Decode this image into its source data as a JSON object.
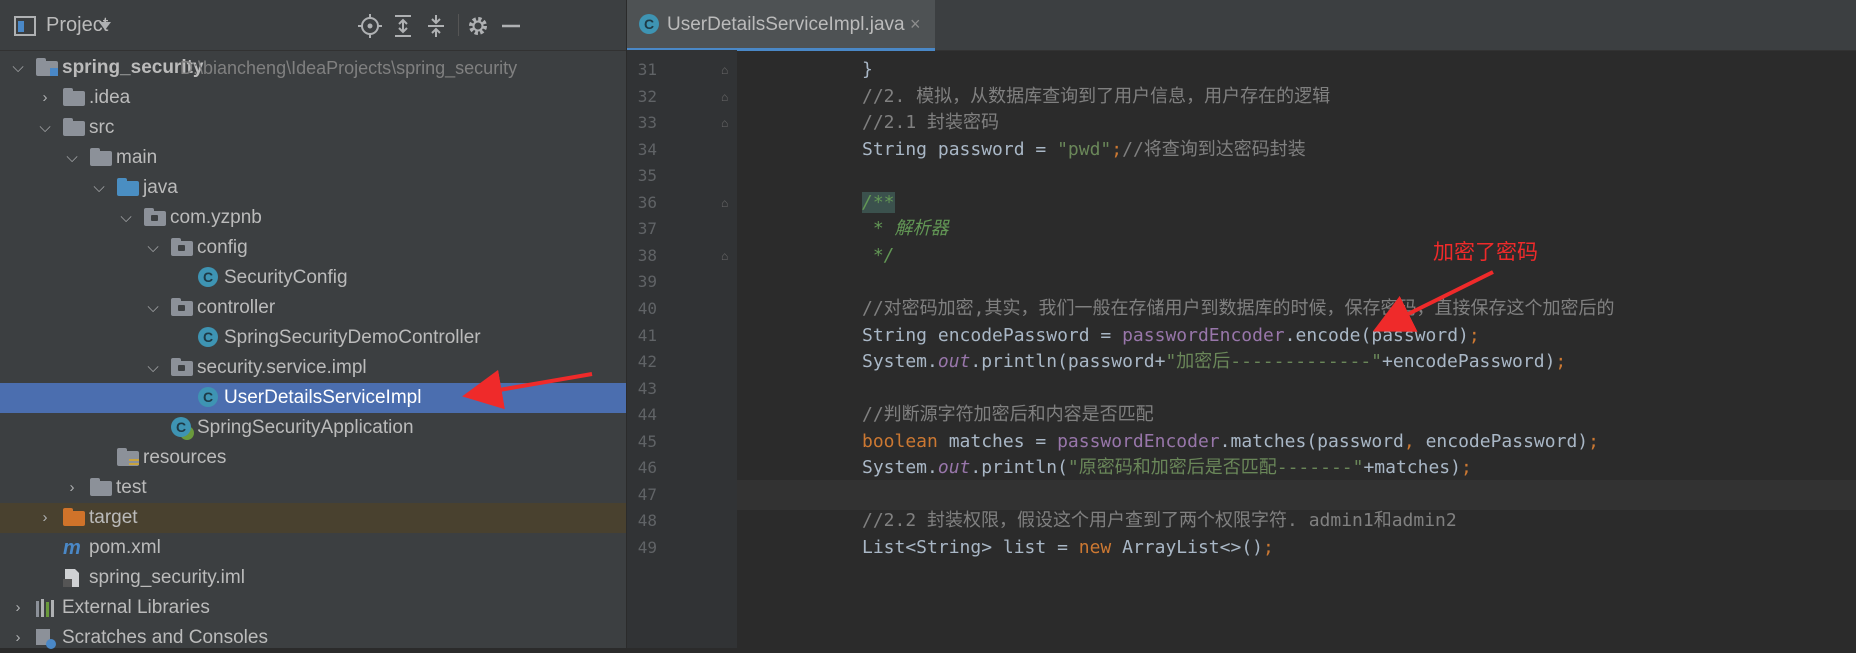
{
  "project_pane": {
    "title": "Project",
    "toolbar_icons": [
      "locate-icon",
      "expand-all-icon",
      "collapse-all-icon",
      "gear-icon",
      "hide-icon"
    ]
  },
  "tree": [
    {
      "label": "spring_security",
      "path": "D:\\biancheng\\IdeaProjects\\spring_security",
      "icon": "module-folder-icon",
      "level": 0,
      "expanded": true,
      "bold": true
    },
    {
      "label": ".idea",
      "icon": "folder-icon",
      "level": 1,
      "expanded": false
    },
    {
      "label": "src",
      "icon": "folder-icon",
      "level": 1,
      "expanded": true
    },
    {
      "label": "main",
      "icon": "folder-icon",
      "level": 2,
      "expanded": true
    },
    {
      "label": "java",
      "icon": "source-folder-icon",
      "level": 3,
      "expanded": true
    },
    {
      "label": "com.yzpnb",
      "icon": "package-icon",
      "level": 4,
      "expanded": true
    },
    {
      "label": "config",
      "icon": "package-icon",
      "level": 5,
      "expanded": true
    },
    {
      "label": "SecurityConfig",
      "icon": "class-icon",
      "level": 6
    },
    {
      "label": "controller",
      "icon": "package-icon",
      "level": 5,
      "expanded": true
    },
    {
      "label": "SpringSecurityDemoController",
      "icon": "class-icon",
      "level": 6
    },
    {
      "label": "security.service.impl",
      "icon": "package-icon",
      "level": 5,
      "expanded": true
    },
    {
      "label": "UserDetailsServiceImpl",
      "icon": "class-icon",
      "level": 6,
      "selected": true
    },
    {
      "label": "SpringSecurityApplication",
      "icon": "spring-boot-class-icon",
      "level": 5
    },
    {
      "label": "resources",
      "icon": "resources-folder-icon",
      "level": 3
    },
    {
      "label": "test",
      "icon": "folder-icon",
      "level": 2,
      "expanded": false
    },
    {
      "label": "target",
      "icon": "excluded-folder-icon",
      "level": 1,
      "expanded": false,
      "excluded": true
    },
    {
      "label": "pom.xml",
      "icon": "maven-icon",
      "level": 1
    },
    {
      "label": "spring_security.iml",
      "icon": "iml-file-icon",
      "level": 1
    },
    {
      "label": "External Libraries",
      "icon": "libraries-icon",
      "level": 0,
      "expanded": false
    },
    {
      "label": "Scratches and Consoles",
      "icon": "scratches-icon",
      "level": 0,
      "expanded": false
    }
  ],
  "editor": {
    "tab": {
      "label": "UserDetailsServiceImpl.java",
      "close": "×"
    },
    "current_line": 47,
    "lines": [
      {
        "n": "31",
        "code": [
          {
            "t": "}",
            "c": "plain"
          }
        ]
      },
      {
        "n": "32",
        "code": [
          {
            "t": "//2. 模拟，从数据库查询到了用户信息，用户存在的逻辑",
            "c": "comment"
          }
        ]
      },
      {
        "n": "33",
        "code": [
          {
            "t": "//2.1 封装密码",
            "c": "comment"
          }
        ]
      },
      {
        "n": "34",
        "code": [
          {
            "t": "String password = ",
            "c": "plain"
          },
          {
            "t": "\"pwd\"",
            "c": "str"
          },
          {
            "t": ";",
            "c": "kw"
          },
          {
            "t": "//将查询到达密码封装",
            "c": "comment"
          }
        ]
      },
      {
        "n": "35",
        "code": []
      },
      {
        "n": "36",
        "code": [
          {
            "t": "/**",
            "c": "doc-hl"
          }
        ]
      },
      {
        "n": "37",
        "code": [
          {
            "t": " * 解析器",
            "c": "doc"
          }
        ]
      },
      {
        "n": "38",
        "code": [
          {
            "t": " */",
            "c": "doc"
          }
        ]
      },
      {
        "n": "39",
        "code": []
      },
      {
        "n": "40",
        "code": [
          {
            "t": "//对密码加密,其实，我们一般在存储用户到数据库的时候，保存密码，直接保存这个加密后的",
            "c": "comment"
          }
        ]
      },
      {
        "n": "41",
        "code": [
          {
            "t": "String encodePassword = ",
            "c": "plain"
          },
          {
            "t": "passwordEncoder",
            "c": "field"
          },
          {
            "t": ".encode(password)",
            "c": "plain"
          },
          {
            "t": ";",
            "c": "kw"
          }
        ]
      },
      {
        "n": "42",
        "code": [
          {
            "t": "System.",
            "c": "plain"
          },
          {
            "t": "out",
            "c": "static"
          },
          {
            "t": ".println(password+",
            "c": "plain"
          },
          {
            "t": "\"加密后-------------\"",
            "c": "str"
          },
          {
            "t": "+encodePassword)",
            "c": "plain"
          },
          {
            "t": ";",
            "c": "kw"
          }
        ]
      },
      {
        "n": "43",
        "code": []
      },
      {
        "n": "44",
        "code": [
          {
            "t": "//判断源字符加密后和内容是否匹配",
            "c": "comment"
          }
        ]
      },
      {
        "n": "45",
        "code": [
          {
            "t": "boolean ",
            "c": "kw"
          },
          {
            "t": "matches = ",
            "c": "plain"
          },
          {
            "t": "passwordEncoder",
            "c": "field"
          },
          {
            "t": ".matches(password",
            "c": "plain"
          },
          {
            "t": ", ",
            "c": "kw"
          },
          {
            "t": "encodePassword)",
            "c": "plain"
          },
          {
            "t": ";",
            "c": "kw"
          }
        ]
      },
      {
        "n": "46",
        "code": [
          {
            "t": "System.",
            "c": "plain"
          },
          {
            "t": "out",
            "c": "static"
          },
          {
            "t": ".println(",
            "c": "plain"
          },
          {
            "t": "\"原密码和加密后是否匹配-------\"",
            "c": "str"
          },
          {
            "t": "+matches)",
            "c": "plain"
          },
          {
            "t": ";",
            "c": "kw"
          }
        ]
      },
      {
        "n": "47",
        "code": []
      },
      {
        "n": "48",
        "code": [
          {
            "t": "//2.2 封装权限，假设这个用户查到了两个权限字符. admin1和admin2",
            "c": "comment"
          }
        ]
      },
      {
        "n": "49",
        "code": [
          {
            "t": "List<String> list = ",
            "c": "plain"
          },
          {
            "t": "new ",
            "c": "kw"
          },
          {
            "t": "ArrayList<>()",
            "c": "plain"
          },
          {
            "t": ";",
            "c": "kw"
          }
        ]
      }
    ]
  },
  "annotation": {
    "label": "加密了密码",
    "color": "#ef2a2a"
  }
}
